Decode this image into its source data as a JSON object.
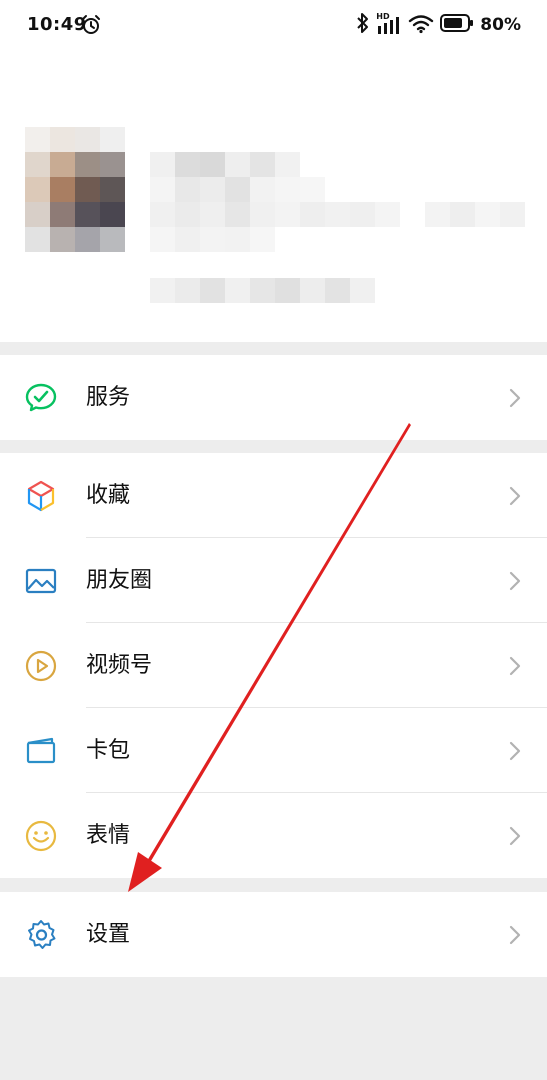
{
  "status_bar": {
    "time": "10:49",
    "battery_percent": "80%",
    "network_badge": "HD",
    "icons": [
      "alarm-icon",
      "bluetooth-icon",
      "signal-icon",
      "wifi-icon",
      "battery-icon"
    ]
  },
  "profile": {
    "avatar": "pixelated-avatar",
    "name_redacted": true
  },
  "menu": {
    "services": {
      "label": "服务",
      "icon": "wechat-pay-icon"
    },
    "favorites": {
      "label": "收藏",
      "icon": "cube-icon"
    },
    "moments": {
      "label": "朋友圈",
      "icon": "image-icon"
    },
    "channels": {
      "label": "视频号",
      "icon": "play-circle-icon"
    },
    "cards": {
      "label": "卡包",
      "icon": "card-icon"
    },
    "stickers": {
      "label": "表情",
      "icon": "smiley-icon"
    },
    "settings": {
      "label": "设置",
      "icon": "gear-icon"
    }
  },
  "colors": {
    "background": "#ededed",
    "surface": "#ffffff",
    "accent_green": "#07c160",
    "annotation_arrow": "#e02020",
    "chevron": "#b2b2b2"
  }
}
